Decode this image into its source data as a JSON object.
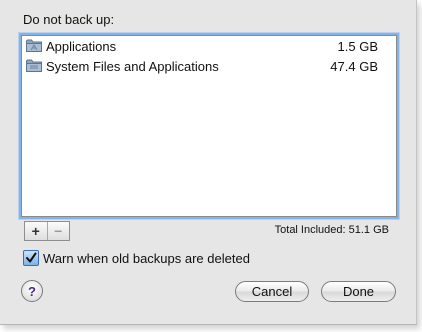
{
  "sheet": {
    "heading": "Do not back up:"
  },
  "exclusions": [
    {
      "name": "Applications",
      "size": "1.5 GB",
      "icon": "folder-icon"
    },
    {
      "name": "System Files and Applications",
      "size": "47.4 GB",
      "icon": "folder-icon"
    }
  ],
  "controls": {
    "add_label": "+",
    "remove_label": "−",
    "total": "Total Included: 51.1 GB"
  },
  "warn_checkbox": {
    "label": "Warn when old backups are deleted",
    "checked": true
  },
  "help": {
    "label": "?"
  },
  "buttons": {
    "cancel": "Cancel",
    "done": "Done"
  },
  "colors": {
    "focus_ring": "#86b3e6",
    "checkbox": "#7fb1ea",
    "sheet_bg": "#e6e6e6"
  }
}
